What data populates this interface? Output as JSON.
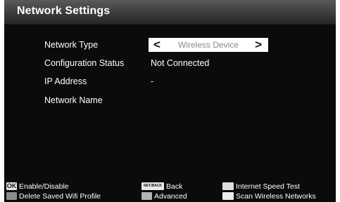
{
  "header": {
    "title": "Network Settings"
  },
  "settings": {
    "network_type": {
      "label": "Network Type",
      "value": "Wireless Device",
      "left_arrow": "<",
      "right_arrow": ">"
    },
    "configuration_status": {
      "label": "Configuration Status",
      "value": "Not Connected"
    },
    "ip_address": {
      "label": "IP Address",
      "value": "-"
    },
    "network_name": {
      "label": "Network Name",
      "value": ""
    }
  },
  "legend": {
    "ok": {
      "key": "OK",
      "label": "Enable/Disable"
    },
    "back": {
      "key": "RET./BACK",
      "label": "Back"
    },
    "speed_test": {
      "label": "Internet Speed Test",
      "color": "#dcdcdc"
    },
    "delete_profile": {
      "label": "Delete Saved Wifi Profile",
      "color": "#8c8c8c"
    },
    "advanced": {
      "label": "Advanced",
      "color": "#b4b4b4"
    },
    "scan": {
      "label": "Scan Wireless Networks",
      "color": "#ececec"
    }
  }
}
